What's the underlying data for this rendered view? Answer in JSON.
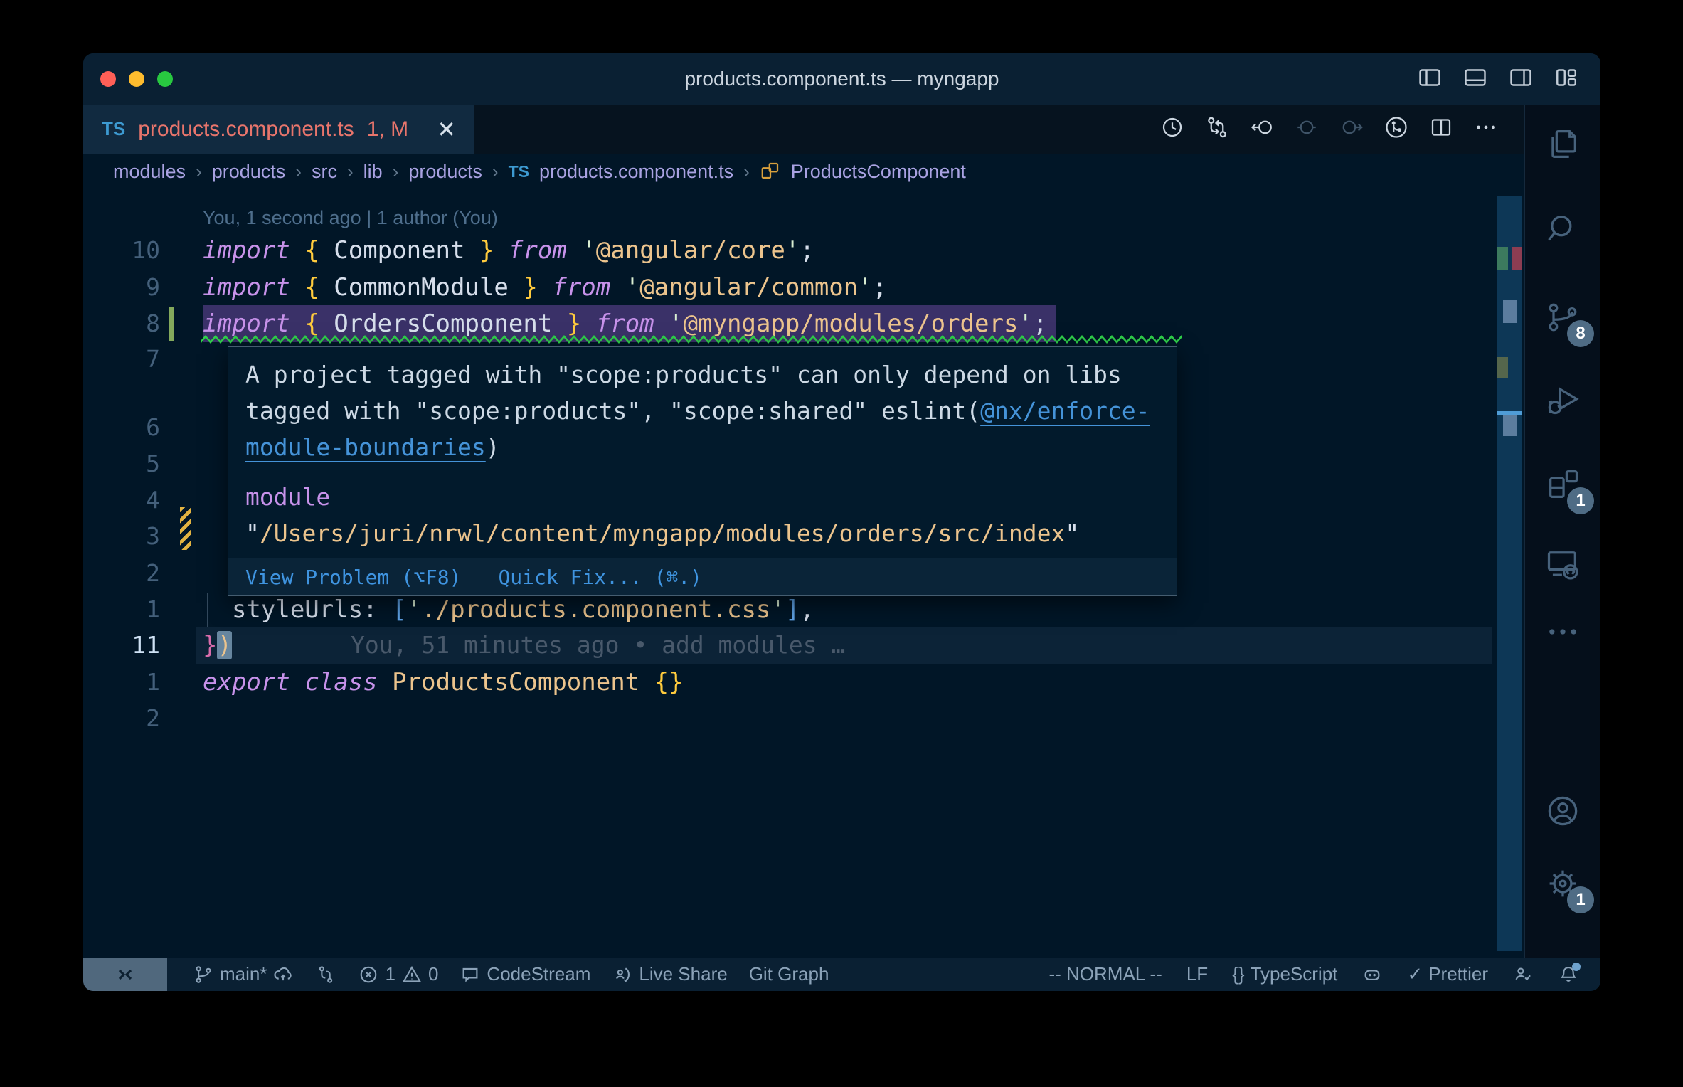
{
  "window": {
    "title": "products.component.ts — myngapp"
  },
  "tab": {
    "type_label": "TS",
    "name": "products.component.ts",
    "badge": "1, M",
    "close": "✕"
  },
  "breadcrumb": {
    "separator": "›",
    "dirs": [
      "modules",
      "products",
      "src",
      "lib",
      "products"
    ],
    "file_type": "TS",
    "file": "products.component.ts",
    "symbol": "ProductsComponent"
  },
  "editor": {
    "rows": [
      {
        "n": "",
        "blame": "You, 1 second ago | 1 author (You)"
      },
      {
        "n": "10",
        "t": [
          [
            "import",
            "kw"
          ],
          [
            " ",
            "pl"
          ],
          [
            "{",
            "br"
          ],
          [
            " Component ",
            "pl"
          ],
          [
            "}",
            "br"
          ],
          [
            " ",
            "pl"
          ],
          [
            "from",
            "kw"
          ],
          [
            " ",
            "pl"
          ],
          [
            "'",
            "q"
          ],
          [
            "@angular/core",
            "str"
          ],
          [
            "'",
            "q"
          ],
          [
            ";",
            "pl"
          ]
        ]
      },
      {
        "n": "9",
        "t": [
          [
            "import",
            "kw"
          ],
          [
            " ",
            "pl"
          ],
          [
            "{",
            "br"
          ],
          [
            " CommonModule ",
            "pl"
          ],
          [
            "}",
            "br"
          ],
          [
            " ",
            "pl"
          ],
          [
            "from",
            "kw"
          ],
          [
            " ",
            "pl"
          ],
          [
            "'",
            "q"
          ],
          [
            "@angular/common",
            "str"
          ],
          [
            "'",
            "q"
          ],
          [
            ";",
            "pl"
          ]
        ]
      },
      {
        "n": "8",
        "sel": true,
        "squig": true,
        "git": "added",
        "t": [
          [
            "import",
            "kw"
          ],
          [
            " ",
            "pl"
          ],
          [
            "{",
            "br"
          ],
          [
            " OrdersComponent ",
            "pl"
          ],
          [
            "}",
            "br"
          ],
          [
            " ",
            "pl"
          ],
          [
            "from",
            "kw"
          ],
          [
            " ",
            "pl"
          ],
          [
            "'",
            "q"
          ],
          [
            "@myngapp/modules/orders",
            "str"
          ],
          [
            "'",
            "q"
          ],
          [
            ";",
            "pl"
          ]
        ]
      },
      {
        "n": "7"
      },
      {
        "n": "6"
      },
      {
        "n": "5"
      },
      {
        "n": "4"
      },
      {
        "n": "3"
      },
      {
        "n": "2"
      },
      {
        "n": "1",
        "guide": true,
        "t": [
          [
            "  ",
            "pl"
          ],
          [
            "styleUrls",
            "pl"
          ],
          [
            ":",
            "pl"
          ],
          [
            " ",
            "pl"
          ],
          [
            "[",
            "bk"
          ],
          [
            "'",
            "q"
          ],
          [
            "./products.component.css",
            "str"
          ],
          [
            "'",
            "q"
          ],
          [
            "]",
            "bk"
          ],
          [
            ",",
            "pl"
          ]
        ]
      },
      {
        "n": "11",
        "cur": true,
        "iblame": "You, 51 minutes ago • add modules …",
        "t": [
          [
            "}",
            "pink"
          ],
          [
            ")",
            "str",
            "cursor"
          ]
        ]
      },
      {
        "n": "1",
        "t": [
          [
            "export",
            "kw"
          ],
          [
            " ",
            "pl"
          ],
          [
            "class",
            "kw"
          ],
          [
            " ",
            "pl"
          ],
          [
            "ProductsComponent",
            "cls"
          ],
          [
            " ",
            "pl"
          ],
          [
            "{}",
            "br"
          ]
        ]
      },
      {
        "n": "2"
      }
    ]
  },
  "tooltip": {
    "line1": "A project tagged with \"scope:products\" can only depend on libs",
    "line2_pre": "tagged with \"scope:products\", \"scope:shared\" eslint(",
    "line2_link": "@nx/enforce-",
    "line3_link": "module-boundaries",
    "line3_post": ")",
    "module_keyword": "module",
    "quote": "\"",
    "module_path": "/Users/juri/nrwl/content/myngapp/modules/orders/src/index",
    "actions": {
      "view_problem": "View Problem (⌥F8)",
      "quick_fix": "Quick Fix... (⌘.)"
    }
  },
  "activitybar": {
    "scm_badge": "8",
    "extensions_badge": "1",
    "settings_badge": "1"
  },
  "statusbar": {
    "branch": "main*",
    "errors": "1",
    "warnings": "0",
    "codestream": "CodeStream",
    "liveshare": "Live Share",
    "gitgraph": "Git Graph",
    "mode": "-- NORMAL --",
    "eol": "LF",
    "braces": "{}",
    "language": "TypeScript",
    "prettier_check": "✓",
    "prettier": "Prettier"
  },
  "colors": {
    "editor_bg": "#011627",
    "titlebar_bg": "#0a2033",
    "error_red": "#e8756c",
    "squiggle_green": "#2fd04a",
    "git_added_green": "#84a95c",
    "git_modified_yellow": "#e2b341",
    "keyword_magenta": "#c792ea",
    "string_tan": "#ecc48d",
    "brace_yellow": "#ffcb3d",
    "link_blue": "#4593d8",
    "selection_purple": "#3a3168"
  }
}
